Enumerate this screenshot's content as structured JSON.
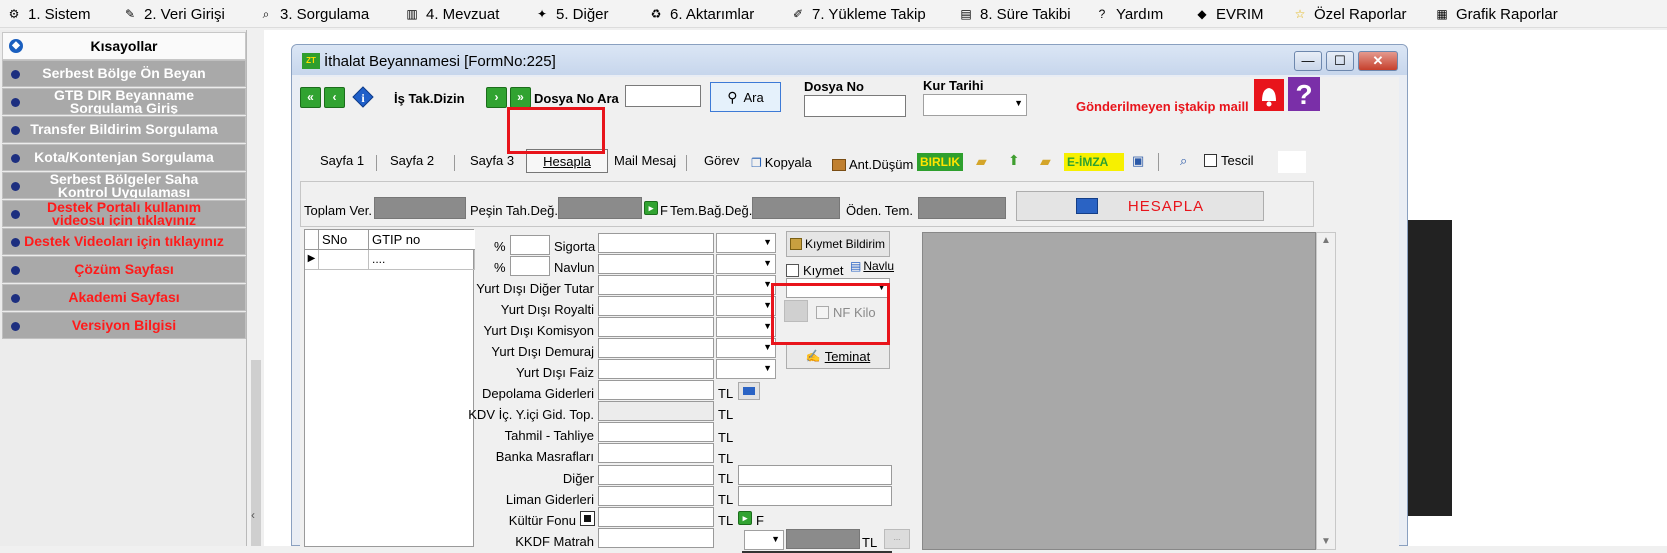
{
  "menubar": {
    "items": [
      {
        "label": "1.  Sistem",
        "icon": "gear-icon"
      },
      {
        "label": "2.  Veri Girişi",
        "icon": "edit-icon"
      },
      {
        "label": "3.  Sorgulama",
        "icon": "query-icon"
      },
      {
        "label": "4.  Mevzuat",
        "icon": "books-icon"
      },
      {
        "label": "5.  Diğer",
        "icon": "tools-icon"
      },
      {
        "label": "6.  Aktarımlar",
        "icon": "transfer-icon"
      },
      {
        "label": "7.  Yükleme Takip",
        "icon": "tracking-icon"
      },
      {
        "label": "8. Süre Takibi",
        "icon": "clock-icon"
      },
      {
        "label": "Yardım",
        "icon": "help-icon"
      },
      {
        "label": "EVRIM",
        "icon": "evrim-icon"
      },
      {
        "label": "Özel Raporlar",
        "icon": "star-icon"
      },
      {
        "label": "Grafik Raporlar",
        "icon": "chart-icon"
      }
    ]
  },
  "sidebar": {
    "title": "Kısayollar",
    "items": [
      {
        "label": "Serbest Bölge Ön Beyan",
        "style": "white"
      },
      {
        "label": "GTB DIR Beyanname Sorgulama Giriş",
        "style": "white"
      },
      {
        "label": "Transfer Bildirim Sorgulama",
        "style": "white"
      },
      {
        "label": "Kota/Kontenjan Sorgulama",
        "style": "white"
      },
      {
        "label": "Serbest Bölgeler Saha Kontrol Uygulaması",
        "style": "white"
      },
      {
        "label": "Destek Portalı kullanım videosu için tıklayınız",
        "style": "red"
      },
      {
        "label": "Destek Videoları için tıklayınız",
        "style": "red"
      },
      {
        "label": "Çözüm Sayfası",
        "style": "red"
      },
      {
        "label": "Akademi Sayfası",
        "style": "red"
      },
      {
        "label": "Versiyon Bilgisi",
        "style": "red"
      }
    ]
  },
  "window": {
    "title": "İthalat Beyannamesi [FormNo:225]",
    "controls": {
      "minimize": "—",
      "maximize": "☐",
      "close": "✕"
    }
  },
  "toolbar": {
    "is_tak_dizin": "İş Tak.Dizin",
    "dosya_no_ara": "Dosya No Ara",
    "ara": "Ara",
    "dosya_no": "Dosya No",
    "kur_tarihi": "Kur Tarihi",
    "warning": "Gönderilmeyen iştakip maill"
  },
  "tabs": [
    {
      "label": "Sayfa 1"
    },
    {
      "label": "Sayfa 2"
    },
    {
      "label": "Sayfa 3"
    },
    {
      "label": "Hesapla"
    },
    {
      "label": "Mail Mesaj"
    },
    {
      "label": "Görev"
    }
  ],
  "actions": {
    "kopyala": "Kopyala",
    "ant_dusum": "Ant.Düşüm",
    "birlik": "BIRLIK",
    "e_imza": "E-İMZA",
    "tescil": "Tescil"
  },
  "summary": {
    "toplam_ver": "Toplam Ver.",
    "pesin_tah": "Peşin Tah.Değ.",
    "f_label": "F",
    "tem_bag": "Tem.Bağ.Değ.",
    "oden_tem": "Öden. Tem.",
    "hesapla": "HESAPLA"
  },
  "grid": {
    "columns": [
      "SNo",
      "GTIP no"
    ],
    "rows": [
      [
        "",
        "...."
      ]
    ]
  },
  "form": {
    "pct": "%",
    "sigorta": "Sigorta",
    "navlun": "Navlun",
    "rows": [
      "Yurt Dışı Diğer Tutar",
      "Yurt Dışı Royalti",
      "Yurt Dışı Komisyon",
      "Yurt Dışı Demuraj",
      "Yurt Dışı Faiz",
      "Depolama Giderleri",
      "KDV İç. Y.içi Gid. Top.",
      "Tahmil - Tahliye",
      "Banka Masrafları",
      "Diğer",
      "Liman Giderleri",
      "Kültür Fonu",
      "KKDF Matrah"
    ],
    "tl": "TL",
    "kiymet_bildirim": "Kıymet Bildirim",
    "kiymet": "Kıymet",
    "navlu": "Navlu",
    "nf_kilo": "NF Kilo",
    "teminat": "Teminat",
    "f": "F"
  },
  "colors": {
    "highlight": "#e8141b",
    "sidebar_item_bg": "#a9a9a9",
    "accent_green": "#31a331"
  }
}
